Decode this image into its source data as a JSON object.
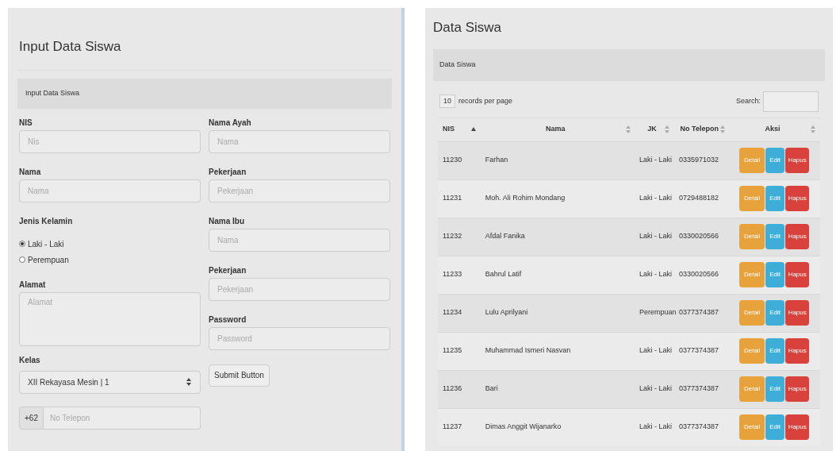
{
  "form_panel": {
    "title": "Input Data Siswa",
    "header": "Input Data Siswa",
    "left_fields": [
      {
        "kind": "text",
        "label": "NIS",
        "placeholder": "Nis"
      },
      {
        "kind": "text",
        "label": "Nama",
        "placeholder": "Nama"
      },
      {
        "kind": "radio",
        "label": "Jenis Kelamin",
        "options": [
          {
            "label": "Laki - Laki",
            "selected": true
          },
          {
            "label": "Perempuan",
            "selected": false
          }
        ]
      },
      {
        "kind": "textarea",
        "label": "Alamat",
        "placeholder": "Alamat"
      },
      {
        "kind": "select",
        "label": "Kelas",
        "value": "XII Rekayasa Mesin | 1"
      },
      {
        "kind": "addon",
        "addon": "+62",
        "placeholder": "No Telepon"
      }
    ],
    "right_fields": [
      {
        "kind": "text",
        "label": "Nama Ayah",
        "placeholder": "Nama"
      },
      {
        "kind": "text",
        "label": "Pekerjaan",
        "placeholder": "Pekerjaan"
      },
      {
        "kind": "text",
        "label": "Nama Ibu",
        "placeholder": "Nama"
      },
      {
        "kind": "text",
        "label": "Pekerjaan",
        "placeholder": "Pekerjaan"
      },
      {
        "kind": "text",
        "label": "Password",
        "placeholder": "Password"
      },
      {
        "kind": "button",
        "label": "Submit Button"
      }
    ]
  },
  "table_panel": {
    "title": "Data Siswa",
    "header": "Data Siswa",
    "page_size": "10",
    "page_size_label": "records per page",
    "search_label": "Search:",
    "columns": [
      {
        "label": "NIS",
        "sorted": true
      },
      {
        "label": "Nama",
        "sorted": false
      },
      {
        "label": "JK",
        "sorted": false
      },
      {
        "label": "No Telepon",
        "sorted": false
      },
      {
        "label": "Aksi",
        "sorted": false
      }
    ],
    "rows": [
      {
        "cells": [
          "11230",
          "Farhan",
          "Laki - Laki",
          "0335971032"
        ],
        "actions": [
          "Detail",
          "Edit",
          "Hapus"
        ]
      },
      {
        "cells": [
          "11231",
          "Moh. Ali Rohim Mondang",
          "Laki - Laki",
          "0729488182"
        ],
        "actions": [
          "Detail",
          "Edit",
          "Hapus"
        ]
      },
      {
        "cells": [
          "11232",
          "Afdal Fanika",
          "Laki - Laki",
          "0330020566"
        ],
        "actions": [
          "Detail",
          "Edit",
          "Hapus"
        ]
      },
      {
        "cells": [
          "11233",
          "Bahrul Latif",
          "Laki - Laki",
          "0330020566"
        ],
        "actions": [
          "Detail",
          "Edit",
          "Hapus"
        ]
      },
      {
        "cells": [
          "11234",
          "Lulu Aprilyani",
          "Perempuan",
          "0377374387"
        ],
        "actions": [
          "Detail",
          "Edit",
          "Hapus"
        ]
      },
      {
        "cells": [
          "11235",
          "Muhammad Ismeri Nasvan",
          "Laki - Laki",
          "0377374387"
        ],
        "actions": [
          "Detail",
          "Edit",
          "Hapus"
        ]
      },
      {
        "cells": [
          "11236",
          "Bari",
          "Laki - Laki",
          "0377374387"
        ],
        "actions": [
          "Detail",
          "Edit",
          "Hapus"
        ]
      },
      {
        "cells": [
          "11237",
          "Dimas Anggit Wijanarko",
          "Laki - Laki",
          "0377374387"
        ],
        "actions": [
          "Detail",
          "Edit",
          "Hapus"
        ]
      }
    ]
  }
}
